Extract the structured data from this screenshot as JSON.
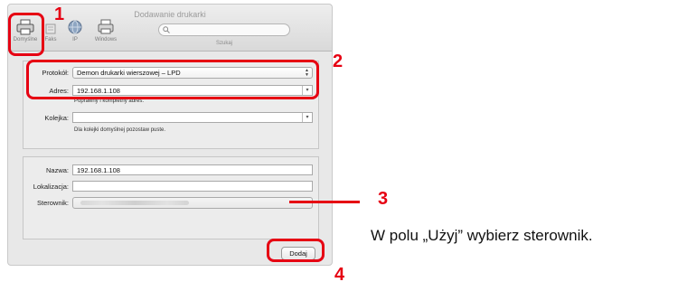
{
  "window": {
    "title": "Dodawanie drukarki"
  },
  "toolbar": {
    "items": [
      {
        "label": "Domyślne",
        "icon": "printer-icon"
      },
      {
        "label": "Faks",
        "icon": "fax-icon"
      },
      {
        "label": "IP",
        "icon": "globe-icon"
      },
      {
        "label": "Windows",
        "icon": "windows-printer-icon"
      }
    ],
    "search_placeholder": "Q",
    "search_label": "Szukaj"
  },
  "form": {
    "protocol_label": "Protokół:",
    "protocol_value": "Demon drukarki wierszowej – LPD",
    "address_label": "Adres:",
    "address_value": "192.168.1.108",
    "address_hint": "Poprawny i kompletny adres.",
    "queue_label": "Kolejka:",
    "queue_value": "",
    "queue_hint": "Dla kolejki domyślnej pozostaw puste.",
    "name_label": "Nazwa:",
    "name_value": "192.168.1.108",
    "location_label": "Lokalizacja:",
    "location_value": "",
    "driver_label": "Sterownik:",
    "add_button": "Dodaj"
  },
  "annotations": {
    "n1": "1",
    "n2": "2",
    "n3": "3",
    "n4": "4",
    "caption": "W polu „Użyj” wybierz sterownik.",
    "color": "#e60012"
  }
}
